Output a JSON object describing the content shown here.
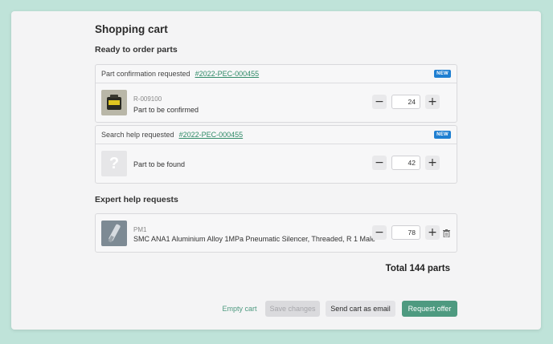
{
  "page": {
    "title": "Shopping cart"
  },
  "sections": {
    "ready": "Ready to order parts",
    "expert": "Expert help requests"
  },
  "cards": [
    {
      "head_label": "Part confirmation requested",
      "link": "#2022-PEC-000455",
      "badge": "NEW",
      "part_id": "R-009100",
      "part_name": "Part to be confirmed",
      "quantity": "24"
    },
    {
      "head_label": "Search help requested",
      "link": "#2022-PEC-000455",
      "badge": "NEW",
      "placeholder_glyph": "?",
      "part_name": "Part to be found",
      "quantity": "42"
    }
  ],
  "expert_item": {
    "part_id": "PM1",
    "part_name": "SMC ANA1 Aluminium Alloy 1MPa Pneumatic Silencer, Threaded, R 1 Male",
    "quantity": "78"
  },
  "stepper": {
    "minus": "−",
    "plus": "+"
  },
  "total": "Total 144 parts",
  "footer": {
    "empty_cart": "Empty cart",
    "save_changes": "Save changes",
    "send_email": "Send cart as email",
    "request_offer": "Request offer"
  },
  "colors": {
    "accent": "#4e9a80",
    "badge": "#1f7fd1",
    "link": "#2f8a67",
    "background": "#bfe3d9"
  }
}
